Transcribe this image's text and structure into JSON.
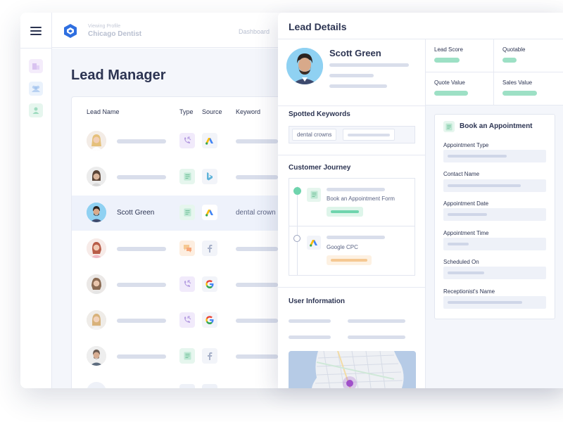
{
  "app": {
    "viewing_label": "Viewing Profile",
    "profile_name": "Chicago Dentist",
    "dashboard_link": "Dashboard",
    "page_title": "Lead Manager"
  },
  "table": {
    "headers": {
      "name": "Lead Name",
      "type": "Type",
      "source": "Source",
      "keyword": "Keyword"
    },
    "rows": [
      {
        "name": "",
        "type": "call-icon",
        "source": "google-ads-icon",
        "keyword": ""
      },
      {
        "name": "",
        "type": "form-icon",
        "source": "bing-icon",
        "keyword": ""
      },
      {
        "name": "Scott Green",
        "type": "form-icon",
        "source": "google-ads-icon",
        "keyword": "dental crown",
        "selected": true
      },
      {
        "name": "",
        "type": "chat-icon",
        "source": "facebook-icon",
        "keyword": ""
      },
      {
        "name": "",
        "type": "call-icon",
        "source": "google-icon",
        "keyword": ""
      },
      {
        "name": "",
        "type": "call-icon",
        "source": "google-icon",
        "keyword": ""
      },
      {
        "name": "",
        "type": "form-icon",
        "source": "facebook-icon",
        "keyword": ""
      }
    ]
  },
  "detail": {
    "title": "Lead Details",
    "lead_name": "Scott Green",
    "stats": [
      {
        "label": "Lead Score"
      },
      {
        "label": "Quotable"
      },
      {
        "label": "Quote Value"
      },
      {
        "label": "Sales Value"
      }
    ],
    "spotted_keywords_title": "Spotted Keywords",
    "keyword_tag": "dental crowns",
    "customer_journey_title": "Customer Journey",
    "journey": [
      {
        "label": "Book an Appointment Form",
        "icon": "form-icon"
      },
      {
        "label": "Google CPC",
        "icon": "google-ads-icon"
      }
    ],
    "user_info_title": "User Information",
    "appointment": {
      "title": "Book an Appointment",
      "fields": [
        "Appointment Type",
        "Contact Name",
        "Appointment Date",
        "Appointment Time",
        "Scheduled On",
        "Receptionist's Name"
      ]
    }
  },
  "colors": {
    "accent_blue": "#2f6fe0",
    "green": "#6fd4ad",
    "orange": "#f5c892",
    "purple_marker": "#a04fc9",
    "text_dark": "#2c3452"
  }
}
